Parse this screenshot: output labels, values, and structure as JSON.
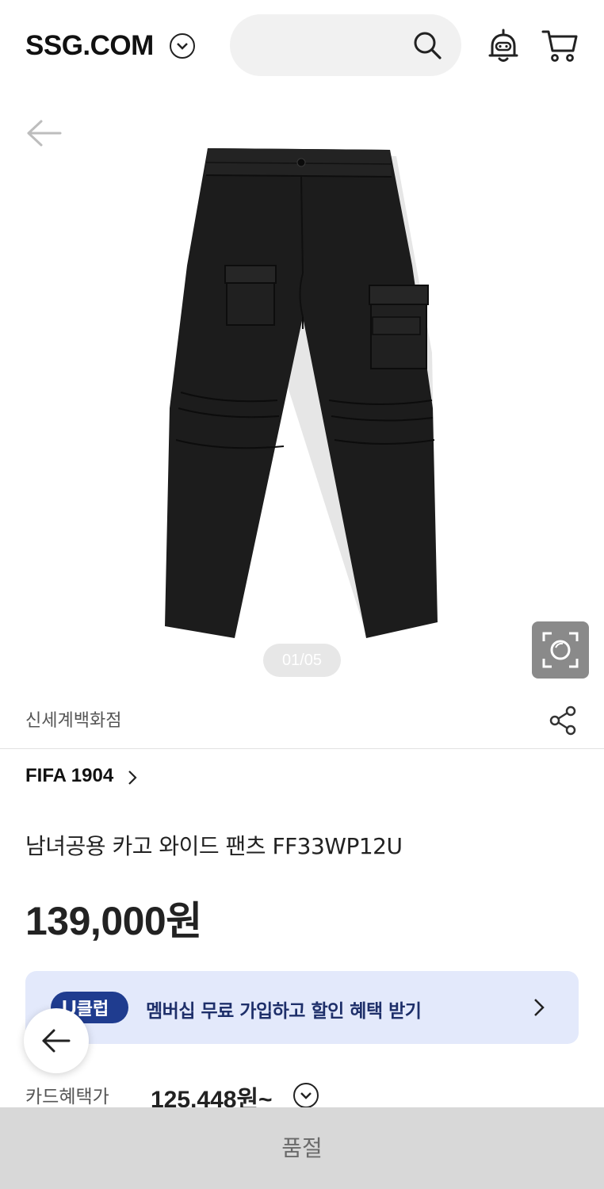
{
  "header": {
    "logo": "SSG.COM",
    "search_placeholder": ""
  },
  "gallery": {
    "counter": "01/05"
  },
  "seller": {
    "name": "신세계백화점"
  },
  "product": {
    "brand": "FIFA 1904",
    "title": "남녀공용 카고 와이드 팬츠 FF33WP12U",
    "price": "139,000원"
  },
  "membership": {
    "badge_u": "U",
    "badge_text": "클럽",
    "text": "멤버십 무료 가입하고 할인 혜택 받기"
  },
  "card_benefit": {
    "label": "카드혜택가",
    "price": "125,448원~"
  },
  "bottom": {
    "status": "품절"
  },
  "colors": {
    "banner_bg": "#e3e9fb",
    "badge_bg": "#1f3c8f",
    "bottom_bar": "#d8d8d8"
  }
}
